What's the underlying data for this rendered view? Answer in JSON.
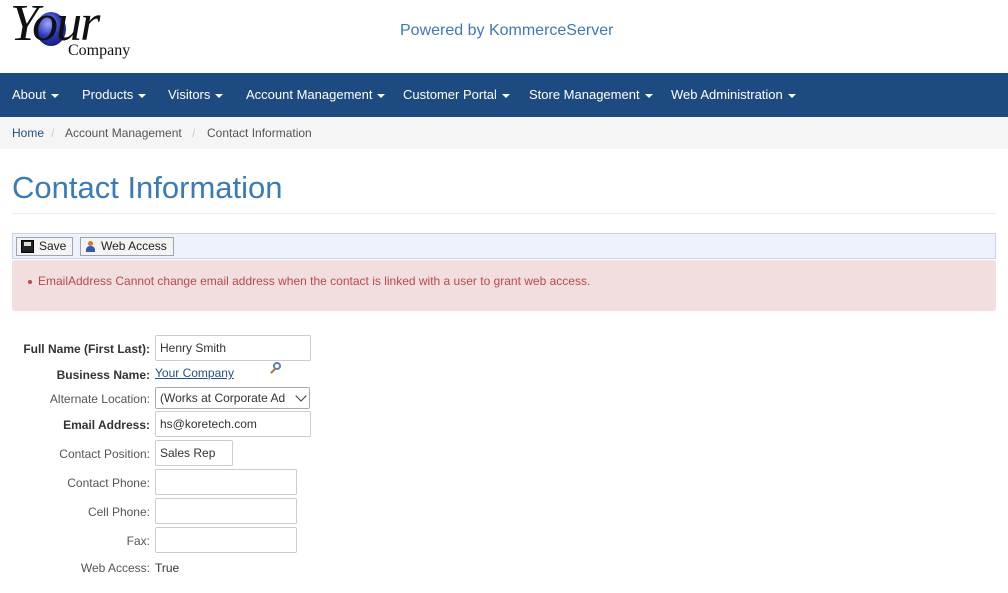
{
  "header": {
    "logo_big": "Your",
    "logo_small": "Company",
    "powered_by": "Powered by KommerceServer"
  },
  "nav": [
    {
      "label": "About"
    },
    {
      "label": "Products"
    },
    {
      "label": "Visitors"
    },
    {
      "label": "Account Management"
    },
    {
      "label": "Customer Portal"
    },
    {
      "label": "Store Management"
    },
    {
      "label": "Web Administration"
    }
  ],
  "breadcrumb": [
    "Home",
    "Account Management",
    "Contact Information"
  ],
  "page_title": "Contact Information",
  "toolbar": {
    "save_label": "Save",
    "web_access_label": "Web Access"
  },
  "alert": {
    "message": "EmailAddress Cannot change email address when the contact is linked with a user to grant web access."
  },
  "form": {
    "full_name_label": "Full Name (First Last):",
    "full_name_value": "Henry Smith",
    "business_label": "Business Name:",
    "business_value": "Your Company",
    "alt_location_label": "Alternate Location:",
    "alt_location_value": "(Works at Corporate Address)",
    "email_label": "Email Address:",
    "email_value": "hs@koretech.com",
    "position_label": "Contact Position:",
    "position_value": "Sales Rep",
    "phone_label": "Contact Phone:",
    "phone_value": "",
    "cell_label": "Cell Phone:",
    "cell_value": "",
    "fax_label": "Fax:",
    "fax_value": "",
    "web_access_label": "Web Access:",
    "web_access_value": "True"
  },
  "colors": {
    "nav_bg": "#1e4a82",
    "title": "#3a7ab7",
    "alert_bg": "#f2dede",
    "alert_text": "#b94a48"
  }
}
